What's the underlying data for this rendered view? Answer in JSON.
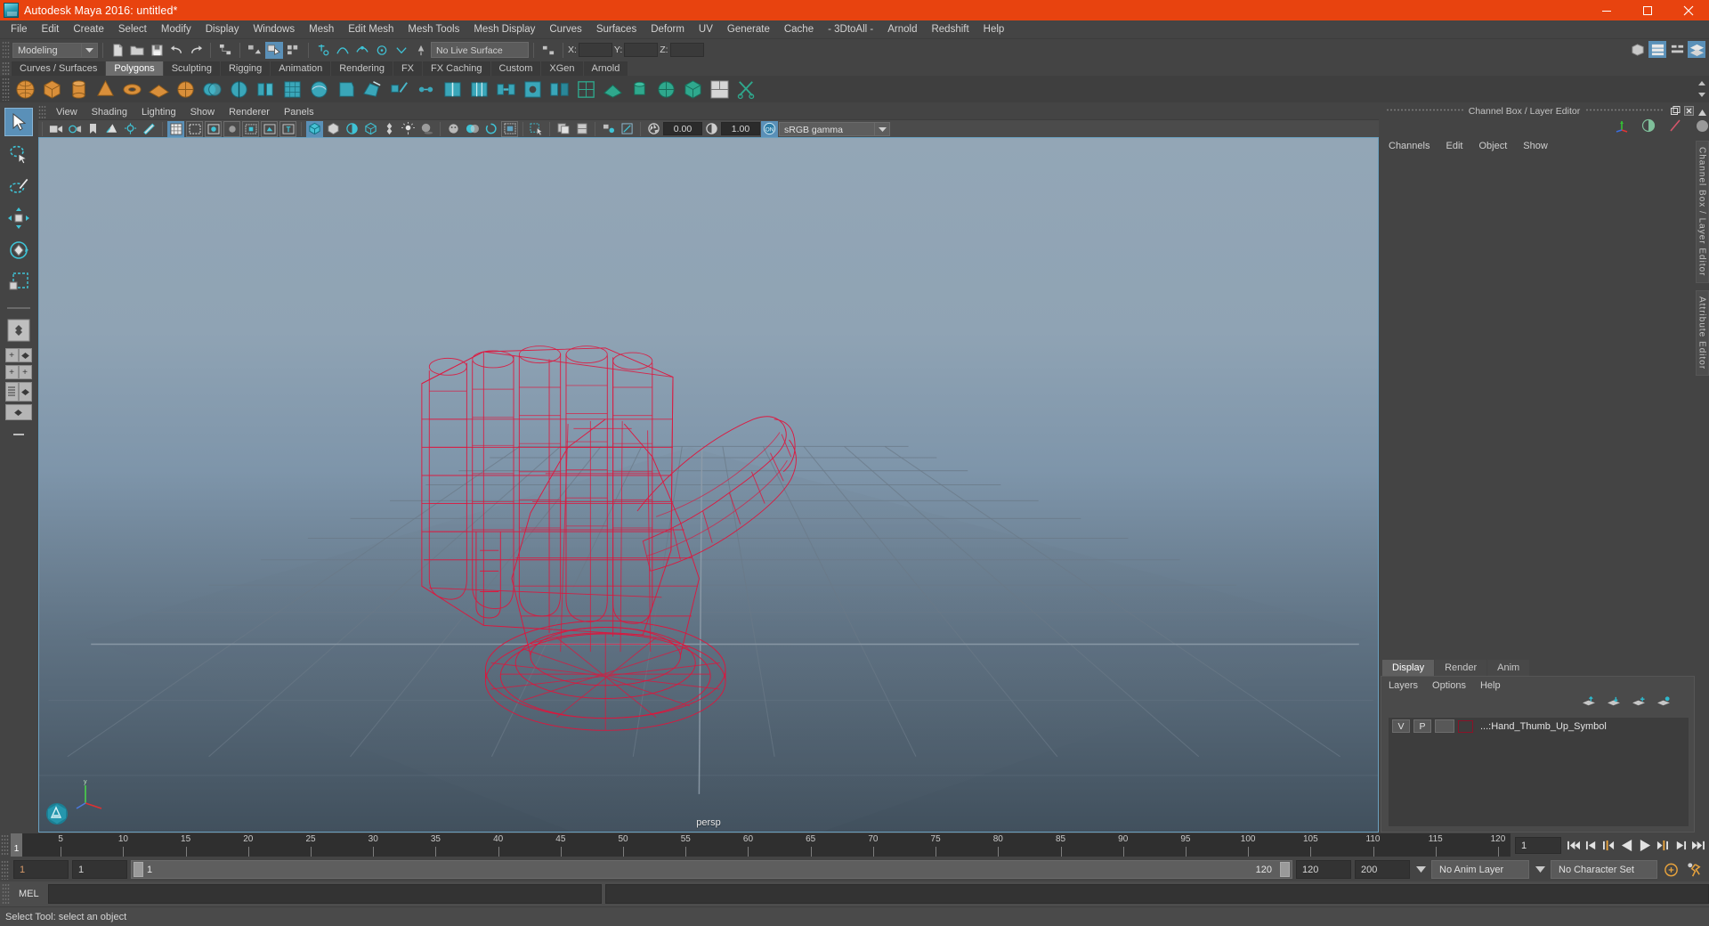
{
  "window": {
    "title": "Autodesk Maya 2016: untitled*",
    "minimize": "minimize-button",
    "maximize": "maximize-button",
    "close": "close-button"
  },
  "menubar": {
    "items": [
      "File",
      "Edit",
      "Create",
      "Select",
      "Modify",
      "Display",
      "Windows",
      "Mesh",
      "Edit Mesh",
      "Mesh Tools",
      "Mesh Display",
      "Curves",
      "Surfaces",
      "Deform",
      "UV",
      "Generate",
      "Cache",
      "- 3DtoAll -",
      "Arnold",
      "Redshift",
      "Help"
    ]
  },
  "statusline": {
    "menuset": "Modeling",
    "live_surface": "No Live Surface",
    "x_label": "X:",
    "y_label": "Y:",
    "z_label": "Z:"
  },
  "shelf": {
    "tabs": [
      "Curves / Surfaces",
      "Polygons",
      "Sculpting",
      "Rigging",
      "Animation",
      "Rendering",
      "FX",
      "FX Caching",
      "Custom",
      "XGen",
      "Arnold"
    ],
    "active_tab": "Polygons"
  },
  "viewport": {
    "menus": [
      "View",
      "Shading",
      "Lighting",
      "Show",
      "Renderer",
      "Panels"
    ],
    "exposure": "0.00",
    "gamma": "1.00",
    "color_management": "sRGB gamma",
    "camera_label": "persp",
    "wireframe_color": "#e0143c",
    "grid_color": "#5b6a77"
  },
  "channelbox": {
    "title": "Channel Box / Layer Editor",
    "menus": [
      "Channels",
      "Edit",
      "Object",
      "Show"
    ],
    "vtabs": [
      "Channel Box / Layer Editor",
      "Attribute Editor"
    ]
  },
  "layer_editor": {
    "tabs": [
      "Display",
      "Render",
      "Anim"
    ],
    "active_tab": "Display",
    "menus": [
      "Layers",
      "Options",
      "Help"
    ],
    "layers": [
      {
        "visible": "V",
        "playback": "P",
        "type": "",
        "color": "#c4122f",
        "name": "...:Hand_Thumb_Up_Symbol"
      }
    ]
  },
  "timeline": {
    "current_frame": "1",
    "ticks": [
      5,
      10,
      15,
      20,
      25,
      30,
      35,
      40,
      45,
      50,
      55,
      60,
      65,
      70,
      75,
      80,
      85,
      90,
      95,
      100,
      105,
      110,
      115,
      120
    ],
    "start": 1,
    "end": 120,
    "frame_field": "1"
  },
  "range": {
    "anim_start": "1",
    "range_start": "1",
    "slider_start_label": "1",
    "slider_end_label": "120",
    "range_end": "120",
    "anim_end": "200",
    "anim_layer": "No Anim Layer",
    "character_set": "No Character Set"
  },
  "command": {
    "label": "MEL",
    "value": "",
    "placeholder": ""
  },
  "status": {
    "message": "Select Tool: select an object"
  }
}
